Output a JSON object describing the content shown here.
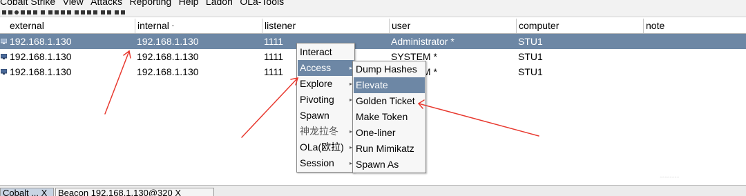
{
  "menubar": {
    "items": [
      "Cobalt Strike",
      "View",
      "Attacks",
      "Reporting",
      "Help",
      "Ladon",
      "OLa-Tools"
    ]
  },
  "table": {
    "columns": [
      "external",
      "internal",
      "listener",
      "user",
      "computer",
      "note"
    ],
    "sort_indicator": "-",
    "rows": [
      {
        "external": "192.168.1.130",
        "internal": "192.168.1.130",
        "listener": "1111",
        "user": "Administrator *",
        "computer": "STU1",
        "note": ""
      },
      {
        "external": "192.168.1.130",
        "internal": "192.168.1.130",
        "listener": "1111",
        "user": "SYSTEM *",
        "computer": "STU1",
        "note": ""
      },
      {
        "external": "192.168.1.130",
        "internal": "192.168.1.130",
        "listener": "1111",
        "user": "SYSTEM *",
        "computer": "STU1",
        "note": ""
      }
    ]
  },
  "context_menu": {
    "items": [
      "Interact",
      "Access",
      "Explore",
      "Pivoting",
      "Spawn",
      "神龙拉冬",
      "OLa(欧拉)",
      "Session"
    ],
    "highlighted": "Access"
  },
  "access_submenu": {
    "items": [
      "Dump Hashes",
      "Elevate",
      "Golden Ticket",
      "Make Token",
      "One-liner",
      "Run Mimikatz",
      "Spawn As"
    ],
    "highlighted": "Elevate"
  },
  "statusbar": {
    "tabs": [
      "Cobalt ... X",
      "Beacon 192.168.1.130@320 X"
    ]
  },
  "colors": {
    "selection": "#6d87a5",
    "annotation_arrow": "#e8392f"
  }
}
